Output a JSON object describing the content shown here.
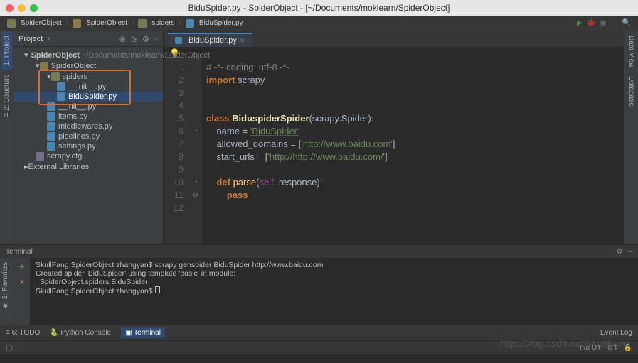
{
  "titlebar": {
    "title": "BiduSpider.py - SpiderObject - [~/Documents/moklearn/SpiderObject]"
  },
  "breadcrumbs": {
    "a": "SpiderObject",
    "b": "SpiderObject",
    "c": "spiders",
    "d": "BiduSpider.py"
  },
  "left_tabs": {
    "project": "1: Project",
    "structure": "≡ 2: Structure",
    "favorites": "★ 2: Favorites"
  },
  "right_tabs": {
    "dataview": "Data View",
    "database": "Database"
  },
  "project_panel": {
    "title": "Project",
    "root": "SpiderObject",
    "root_path": "~/Documents/moklearn/SpiderObject",
    "nodes": {
      "pkg": "SpiderObject",
      "spiders": "spiders",
      "init1": "__init__.py",
      "bidu": "BiduSpider.py",
      "init2": "__init__.py",
      "items": "items.py",
      "middlewares": "middlewares.py",
      "pipelines": "pipelines.py",
      "settings": "settings.py",
      "cfg": "scrapy.cfg",
      "ext": "External Libraries"
    }
  },
  "tabs": {
    "active": "BiduSpider.py"
  },
  "code": {
    "l1_comment": "# -*- coding: utf-8 -*-",
    "l2_import": "import",
    "l2_mod": " scrapy",
    "l5_class": "class",
    "l5_name": " BiduspiderSpider",
    "l5_tail": "(scrapy.Spider):",
    "l6_name_kw": "    name = ",
    "l6_name_val": "'BiduSpider'",
    "l7": "    allowed_domains = [",
    "l7_val": "'http://www.baidu.com'",
    "l7_end": "]",
    "l8": "    start_urls = [",
    "l8_val": "'http://http://www.baidu.com/'",
    "l8_end": "]",
    "l10_def": "    def",
    "l10_name": " parse",
    "l10_sig_a": "(",
    "l10_self": "self",
    "l10_sig_b": ", response):",
    "l11_pass": "        pass",
    "lines": [
      "1",
      "2",
      "3",
      "4",
      "5",
      "6",
      "7",
      "8",
      "9",
      "10",
      "11",
      "12"
    ]
  },
  "terminal": {
    "title": "Terminal",
    "line1": "SkullFang:SpiderObject zhangyan$ scrapy genspider BiduSpider http://www.baidu.com",
    "line2": "Created spider 'BiduSpider' using template 'basic' in module:",
    "line3": "  SpiderObject.spiders.BiduSpider",
    "line4": "SkullFang:SpiderObject zhangyan$ "
  },
  "bottom": {
    "todo": "≡ 6: TODO",
    "pyconsole": "Python Console",
    "terminal": "Terminal",
    "eventlog": "Event Log"
  },
  "status": {
    "enc": "n/a   UTF-8 ‡"
  },
  "watermark": "http://blog.csdn.net/skullFang"
}
